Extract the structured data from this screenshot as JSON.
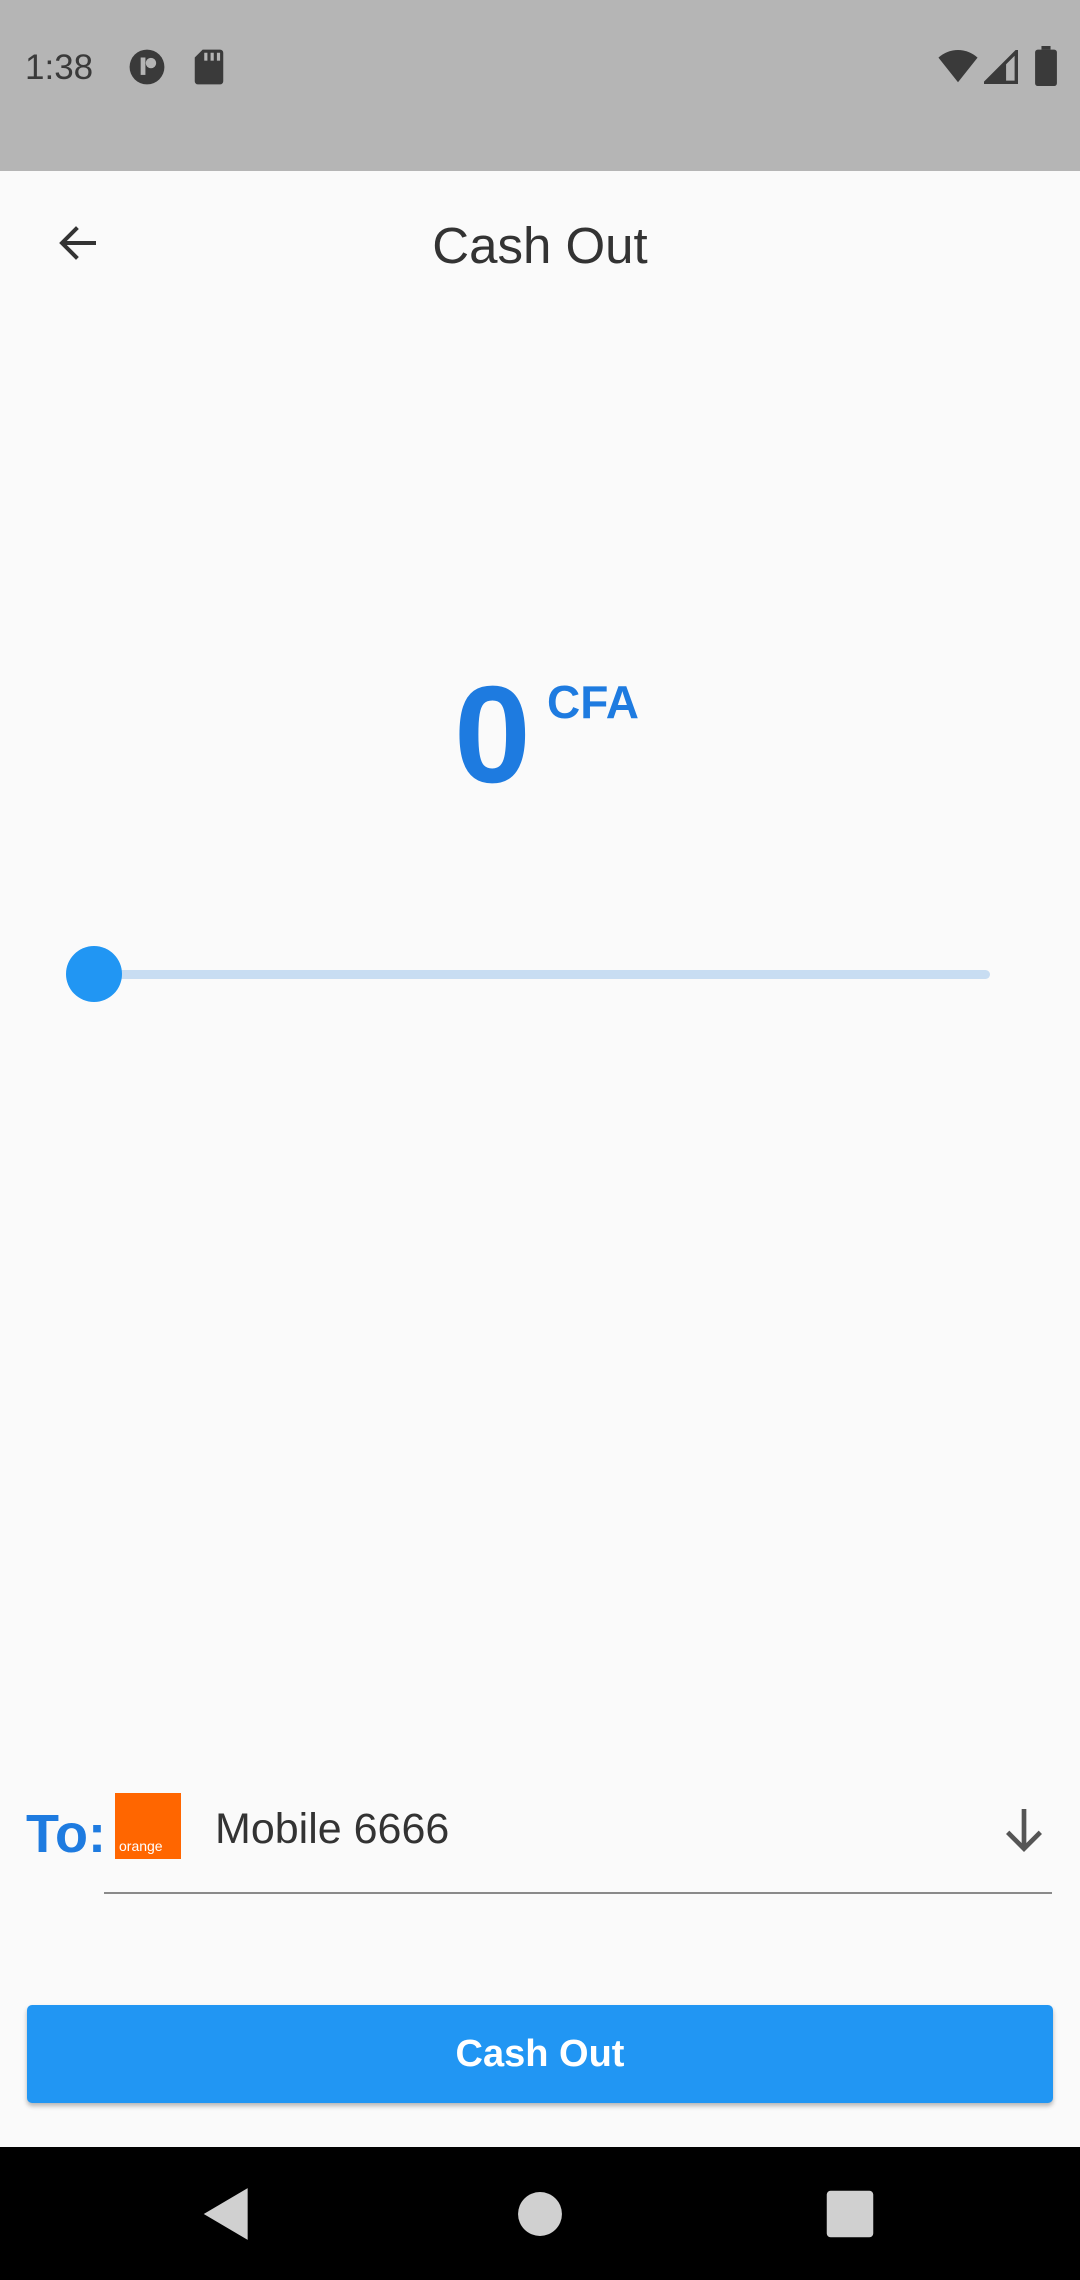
{
  "status_bar": {
    "time": "1:38",
    "left_icons": [
      "app-notification-icon",
      "sd-card-icon"
    ],
    "right_icons": [
      "wifi-icon",
      "cell-signal-icon",
      "battery-icon"
    ]
  },
  "app_bar": {
    "back_icon": "arrow-left-icon",
    "title": "Cash Out"
  },
  "amount": {
    "value": "0",
    "currency": "CFA"
  },
  "slider": {
    "value": 0
  },
  "destination": {
    "label": "To:",
    "provider_logo_text": "orange",
    "account": "Mobile 6666",
    "dropdown_icon": "arrow-down-icon"
  },
  "primary_button": {
    "label": "Cash Out"
  },
  "colors": {
    "accent": "#1e7be0",
    "button": "#2196f3",
    "slider_track": "#c8ddf2",
    "orange_brand": "#ff6600"
  },
  "nav_bar": {
    "buttons": [
      "back-triangle-icon",
      "home-circle-icon",
      "recents-square-icon"
    ]
  }
}
